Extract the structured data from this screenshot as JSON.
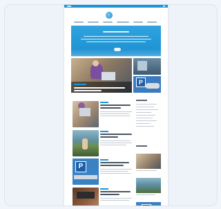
{
  "site": {
    "logo_icon": "cloud-logo-icon",
    "nav_items": 6
  },
  "icons": {
    "menu": "menu-icon",
    "search": "search-icon",
    "parking": "parking-sign-icon"
  },
  "parking_glyph": "P",
  "colors": {
    "accent": "#1e95d4",
    "background": "#f1f4fa",
    "page": "#ffffff"
  }
}
